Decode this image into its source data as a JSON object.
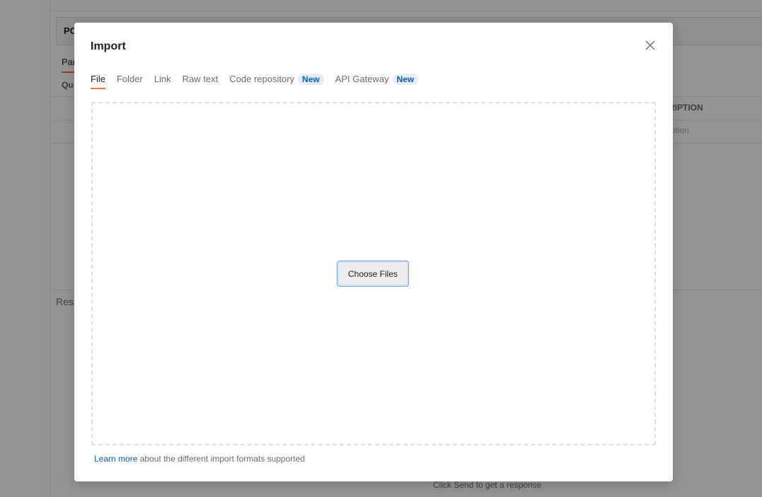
{
  "background": {
    "method": "PO",
    "tab_params": "Par",
    "query_label": "Qu",
    "description_header": "RIPTION",
    "description_placeholder": "iption",
    "response_label": "Resp",
    "send_hint": "Click Send to get a response"
  },
  "modal": {
    "title": "Import",
    "close_icon": "close-icon",
    "tabs": [
      {
        "label": "File",
        "active": true
      },
      {
        "label": "Folder",
        "active": false
      },
      {
        "label": "Link",
        "active": false
      },
      {
        "label": "Raw text",
        "active": false
      },
      {
        "label": "Code repository",
        "badge": "New",
        "active": false
      },
      {
        "label": "API Gateway",
        "badge": "New",
        "active": false
      }
    ],
    "choose_files_label": "Choose Files",
    "footer": {
      "link_text": "Learn more",
      "text": " about the different import formats supported"
    }
  },
  "colors": {
    "accent": "#ff6c37",
    "link": "#0b5cad",
    "badge_bg": "#e5eefb",
    "overlay": "rgba(0,0,0,0.42)"
  }
}
